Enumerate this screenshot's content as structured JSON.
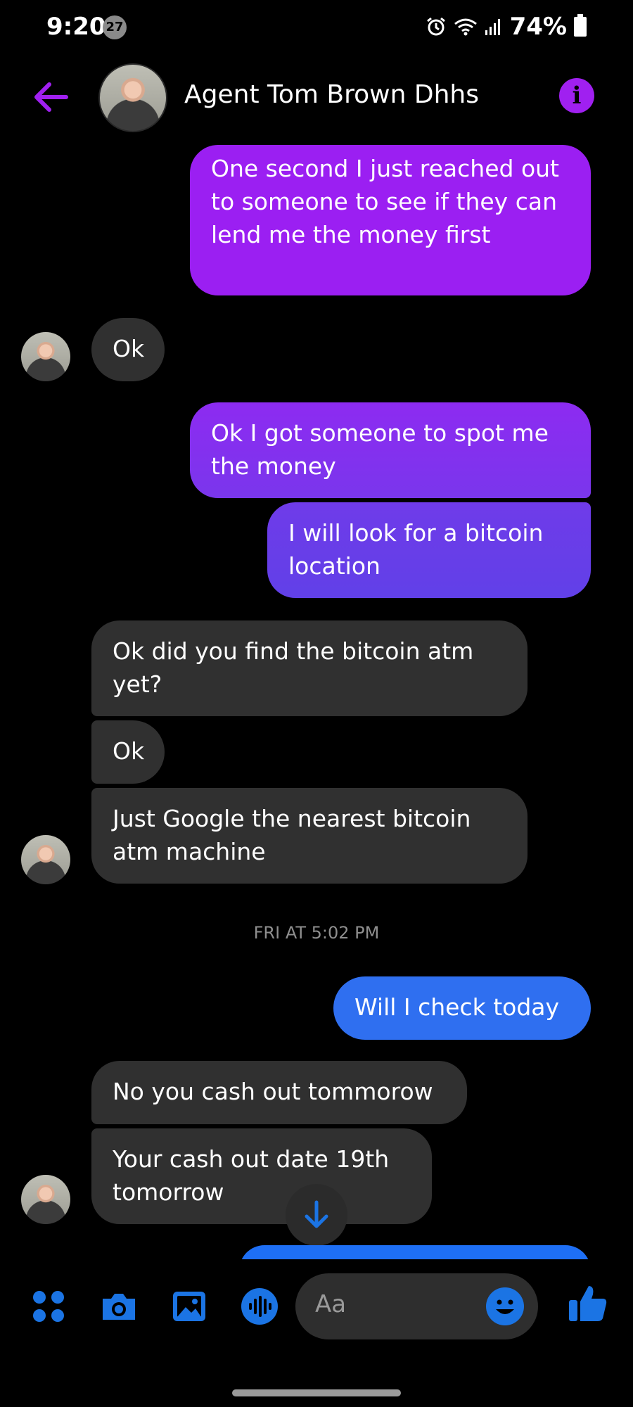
{
  "status_bar": {
    "time": "9:20",
    "notif_count": "27",
    "battery": "74%"
  },
  "header": {
    "contact_name": "Agent Tom Brown Dhhs"
  },
  "messages": [
    {
      "side": "out",
      "text": "One second I just reached out to someone to see if they can lend me the money first"
    },
    {
      "side": "in",
      "text": "Ok"
    },
    {
      "side": "out",
      "text": "Ok I got someone to spot me the money"
    },
    {
      "side": "out",
      "text": "I will look for a bitcoin location"
    },
    {
      "side": "in",
      "text": "Ok did you find the bitcoin atm yet?"
    },
    {
      "side": "in",
      "text": "Ok"
    },
    {
      "side": "in",
      "text": "Just Google the nearest bitcoin atm machine"
    },
    {
      "side": "out",
      "text": "Will I check today"
    },
    {
      "side": "in",
      "text": "No you cash out tommorow"
    },
    {
      "side": "in",
      "text": "Your cash out date 19th tomorrow"
    }
  ],
  "timestamp": "FRI AT 5:02 PM",
  "composer": {
    "placeholder": "Aa"
  },
  "colors": {
    "accent": "#a020f0",
    "out_purple": "#9b1ff2",
    "out_violet": "#6f3be9",
    "out_blue": "#2f6ff0",
    "in_bubble": "#303030"
  }
}
